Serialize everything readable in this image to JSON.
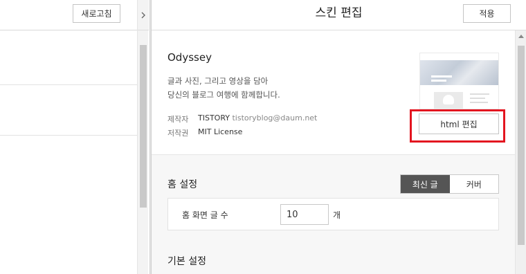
{
  "left": {
    "refresh_label": "새로고침",
    "collapse_icon": "chevron-right-icon"
  },
  "editor": {
    "title": "스킨 편집",
    "apply_label": "적용"
  },
  "skin": {
    "name": "Odyssey",
    "description_line1": "글과 사진, 그리고 영상을 담아",
    "description_line2": "당신의 블로그 여행에 함께합니다.",
    "author_label": "제작자",
    "author_name": "TISTORY",
    "author_email": "tistoryblog@daum.net",
    "copyright_label": "저작권",
    "copyright_value": "MIT License",
    "html_edit_label": "html 편집"
  },
  "home_settings": {
    "title": "홈 설정",
    "tabs": [
      {
        "label": "최신 글",
        "active": true
      },
      {
        "label": "커버",
        "active": false
      }
    ],
    "post_count_label": "홈 화면 글 수",
    "post_count_value": "10",
    "post_count_unit": "개"
  },
  "basic_settings": {
    "title": "기본 설정"
  },
  "colors": {
    "highlight": "#e3141f",
    "active_tab": "#555555"
  }
}
